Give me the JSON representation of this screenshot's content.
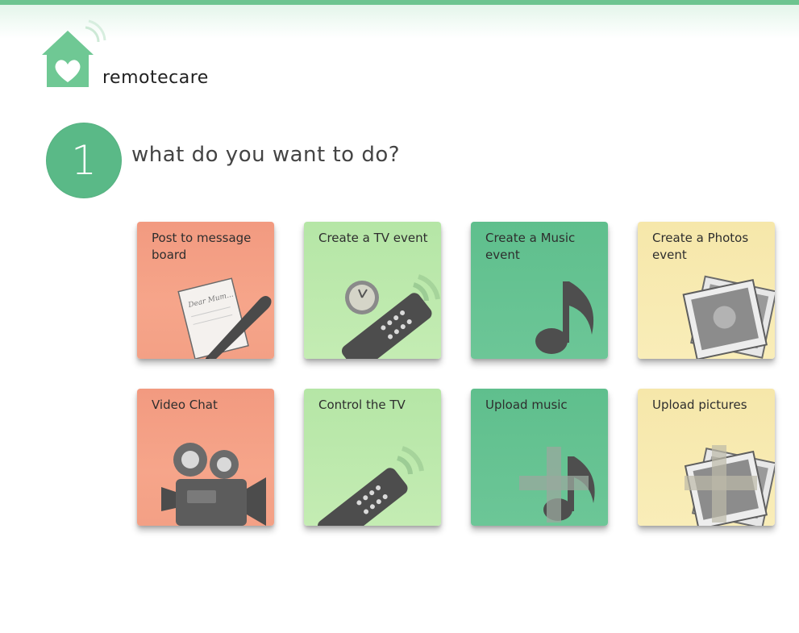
{
  "brand": {
    "name": "remotecare",
    "logo_icon": "house-heart-wifi-icon"
  },
  "step": {
    "number": "1",
    "prompt": "what do you want to do?"
  },
  "colors": {
    "accent": "#5ab987",
    "red_tile": "#f29a80",
    "lime_tile": "#b5e6a6",
    "green_tile": "#5fbf8d",
    "cream_tile": "#f6e7aa"
  },
  "tiles": [
    {
      "label": "Post to message board",
      "icon": "letter-pen-icon",
      "color": "red"
    },
    {
      "label": "Create a TV event",
      "icon": "clock-remote-icon",
      "color": "lime"
    },
    {
      "label": "Create a Music event",
      "icon": "music-note-icon",
      "color": "green"
    },
    {
      "label": "Create a Photos event",
      "icon": "photos-icon",
      "color": "cream"
    },
    {
      "label": "Video Chat",
      "icon": "video-camera-icon",
      "color": "red"
    },
    {
      "label": "Control the TV",
      "icon": "remote-control-icon",
      "color": "lime"
    },
    {
      "label": "Upload music",
      "icon": "music-upload-icon",
      "color": "green"
    },
    {
      "label": "Upload pictures",
      "icon": "pictures-upload-icon",
      "color": "cream"
    }
  ],
  "letter_text": "Dear Mum..."
}
